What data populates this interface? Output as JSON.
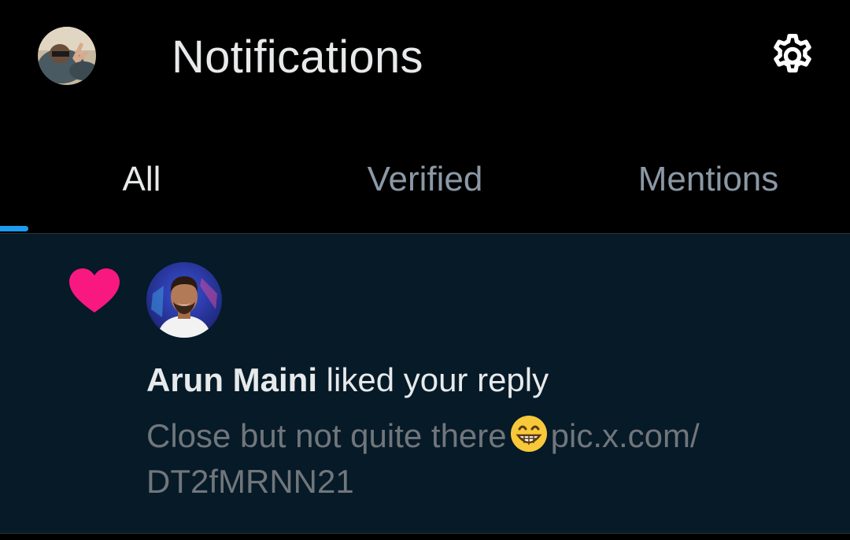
{
  "header": {
    "title": "Notifications",
    "avatar_icon": "user-avatar",
    "settings_icon": "gear-icon"
  },
  "tabs": [
    {
      "label": "All",
      "active": true
    },
    {
      "label": "Verified",
      "active": false
    },
    {
      "label": "Mentions",
      "active": false
    }
  ],
  "notification": {
    "type_icon": "heart-icon",
    "user_name": "Arun Maini",
    "action": "liked your reply",
    "preview_text": "Close but not quite there",
    "preview_emoji": "grinning-face-emoji",
    "preview_link_line1": "pic.x.com/",
    "preview_link_line2": "DT2fMRNN21"
  },
  "colors": {
    "background": "#000000",
    "notification_bg": "#061a28",
    "accent": "#1d9bf0",
    "like": "#f91880",
    "primary_text": "#e7e9ea",
    "secondary_text": "#71767b"
  }
}
